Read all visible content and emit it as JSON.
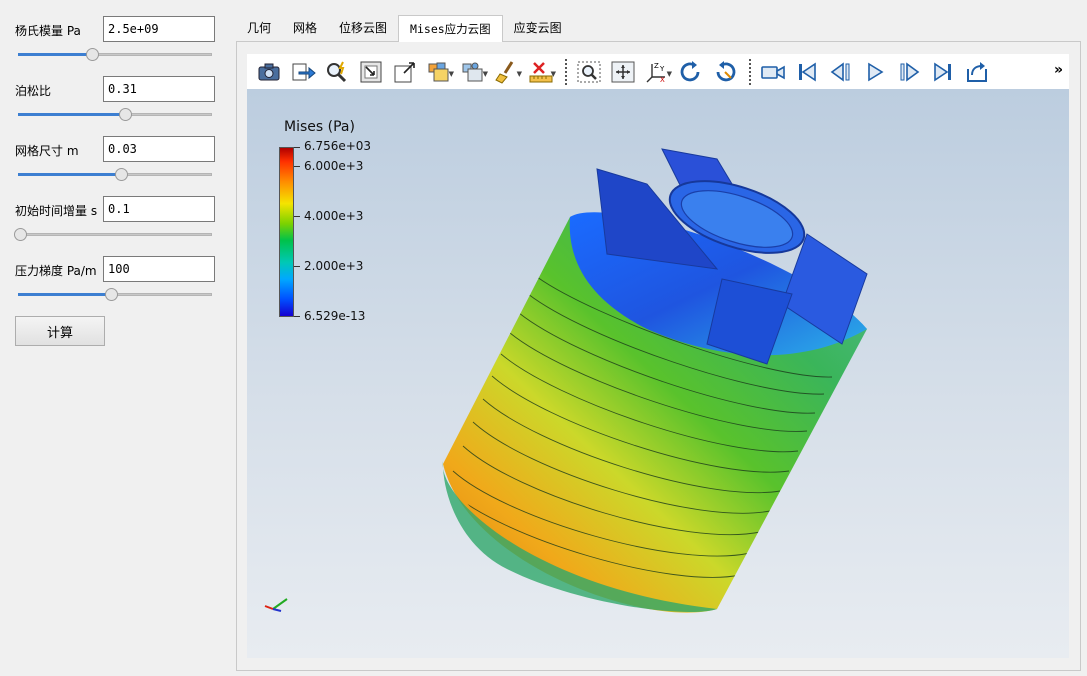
{
  "params": {
    "youngs_label": "杨氏模量 Pa",
    "youngs_value": "2.5e+09",
    "youngs_slider": 0.38,
    "poisson_label": "泊松比",
    "poisson_value": "0.31",
    "poisson_slider": 0.55,
    "mesh_label": "网格尺寸 m",
    "mesh_value": "0.03",
    "mesh_slider": 0.53,
    "dt_label": "初始时间增量 s",
    "dt_value": "0.1",
    "dt_slider": 0.01,
    "pressure_label": "压力梯度 Pa/m",
    "pressure_value": "100",
    "pressure_slider": 0.48
  },
  "calc_button": "计算",
  "tabs": [
    "几何",
    "网格",
    "位移云图",
    "Mises应力云图",
    "应变云图"
  ],
  "active_tab": 3,
  "toolbar": {
    "more": "»",
    "icons": [
      "camera-icon",
      "export-icon",
      "zoom-data-icon",
      "reset-camera-icon",
      "zoom-box-icon",
      "select-cells-icon",
      "select-points-icon",
      "clear-selection-icon",
      "ruler-icon",
      "zoom-to-box-icon",
      "interact-icon",
      "axes-orient-icon",
      "rotate-ccw-icon",
      "rotate-cw-icon",
      "video-camera-icon",
      "first-frame-icon",
      "prev-frame-icon",
      "play-icon",
      "next-frame-icon",
      "last-frame-icon",
      "loop-icon"
    ]
  },
  "legend": {
    "title": "Mises (Pa)",
    "max": "6.756e+03",
    "t6000": "6.000e+3",
    "t4000": "4.000e+3",
    "t2000": "2.000e+3",
    "min": "6.529e-13"
  },
  "colors": {
    "accent": "#3d7fd1",
    "viewport_top": "#bccddf",
    "viewport_bottom": "#e8ecf1"
  }
}
